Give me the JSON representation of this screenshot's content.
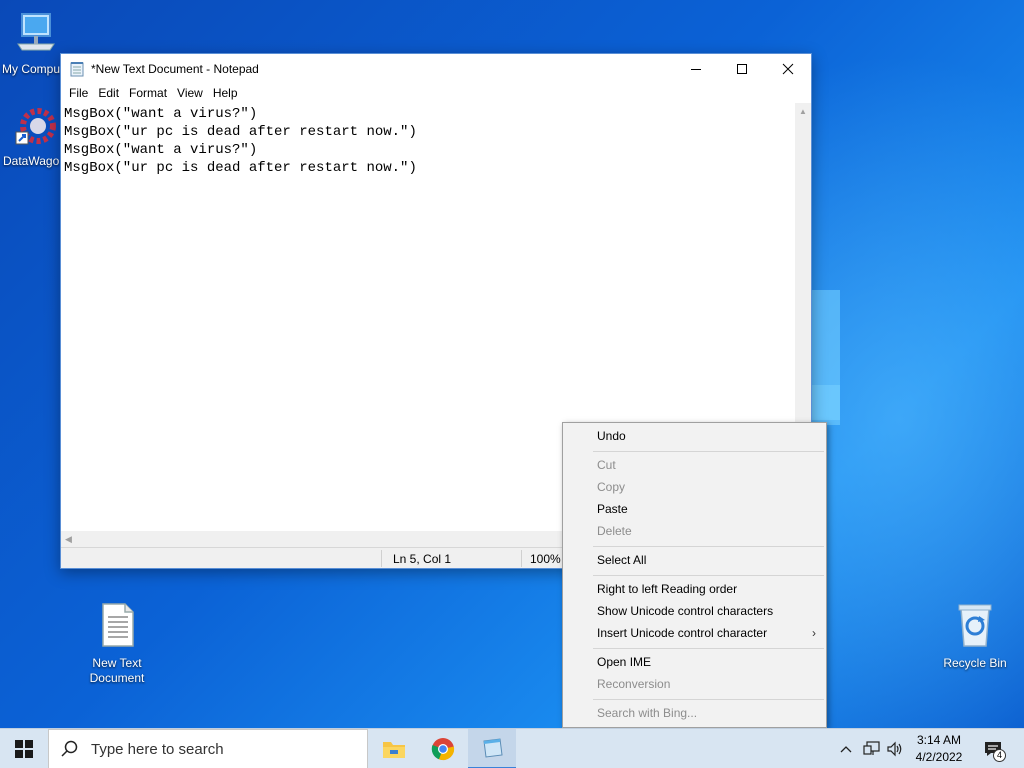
{
  "desktop": {
    "icons": [
      {
        "label": "My Compu"
      },
      {
        "label": "DataWago"
      },
      {
        "label": "New Text Document"
      },
      {
        "label": "Recycle Bin"
      }
    ]
  },
  "notepad": {
    "title": "*New Text Document - Notepad",
    "menu": [
      "File",
      "Edit",
      "Format",
      "View",
      "Help"
    ],
    "content": "MsgBox(\"want a virus?\")\nMsgBox(\"ur pc is dead after restart now.\")\nMsgBox(\"want a virus?\")\nMsgBox(\"ur pc is dead after restart now.\")",
    "status": {
      "position": "Ln 5, Col 1",
      "zoom": "100%"
    }
  },
  "context_menu": {
    "items": [
      {
        "label": "Undo",
        "enabled": true
      },
      {
        "label": "Cut",
        "enabled": false
      },
      {
        "label": "Copy",
        "enabled": false
      },
      {
        "label": "Paste",
        "enabled": true
      },
      {
        "label": "Delete",
        "enabled": false
      },
      {
        "label": "Select All",
        "enabled": true
      },
      {
        "label": "Right to left Reading order",
        "enabled": true
      },
      {
        "label": "Show Unicode control characters",
        "enabled": true
      },
      {
        "label": "Insert Unicode control character",
        "enabled": true
      },
      {
        "label": "Open IME",
        "enabled": true
      },
      {
        "label": "Reconversion",
        "enabled": false
      },
      {
        "label": "Search with Bing...",
        "enabled": false
      }
    ]
  },
  "taskbar": {
    "search_placeholder": "Type here to search",
    "time": "3:14 AM",
    "date": "4/2/2022",
    "notification_count": "4"
  },
  "colors": {
    "accent": "#3b82d8",
    "taskbar": "#d8e5f2",
    "desktop": "#0b62d6"
  }
}
